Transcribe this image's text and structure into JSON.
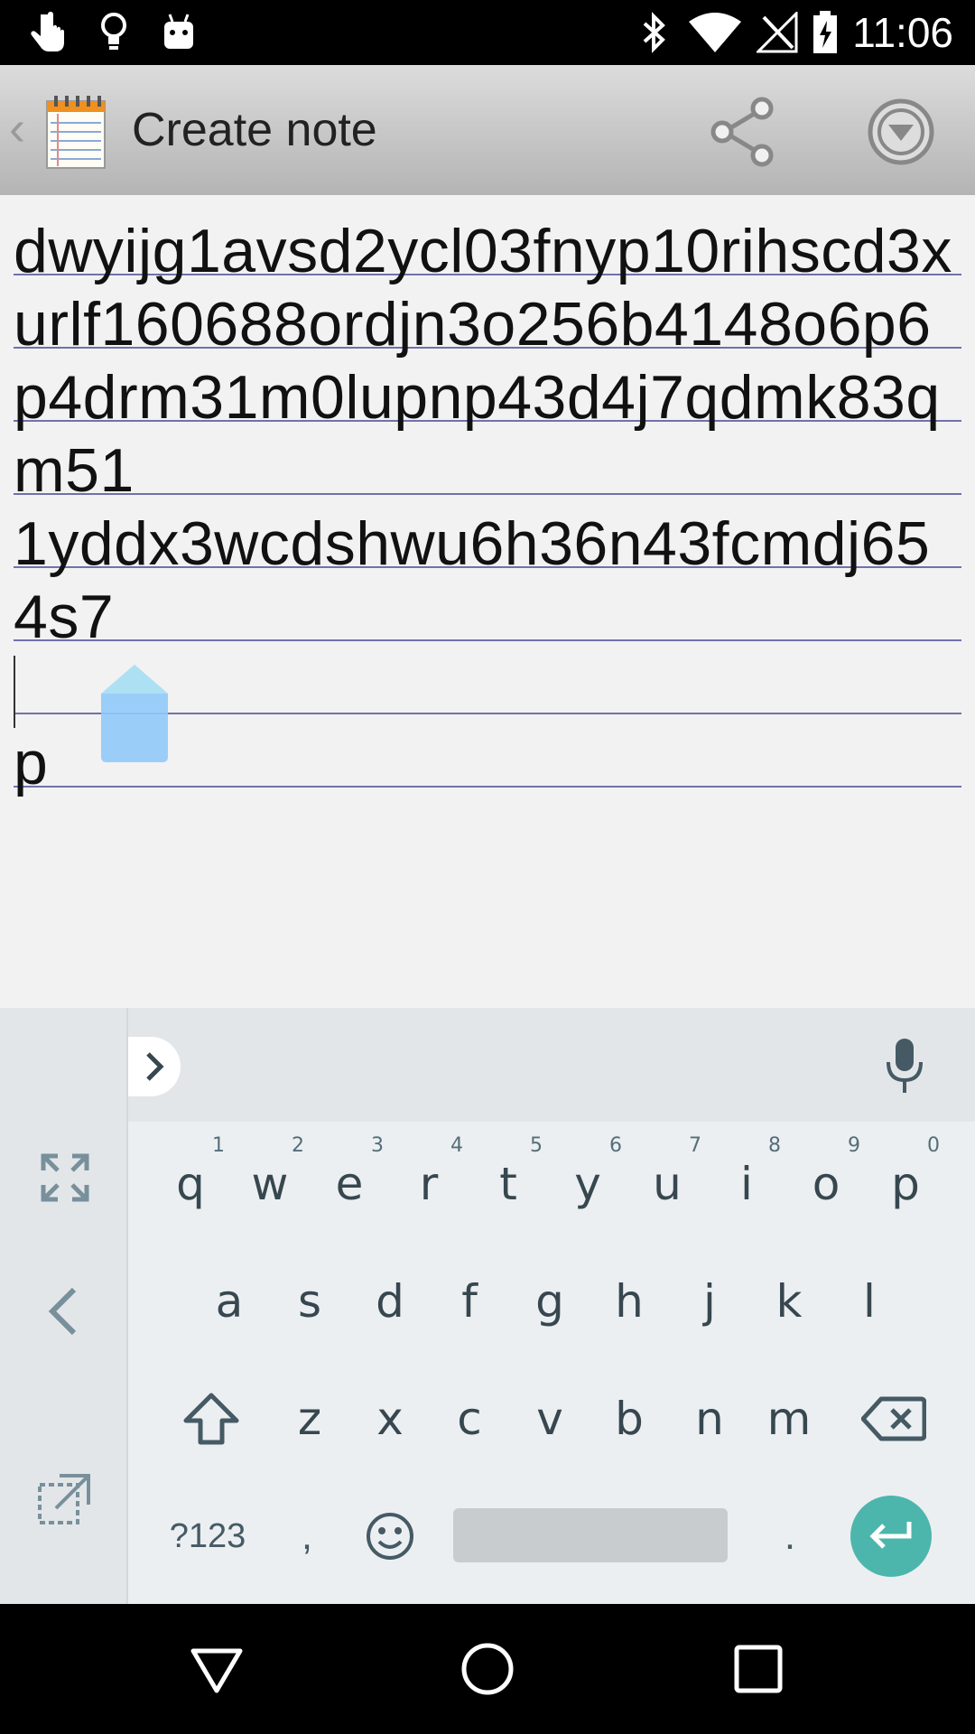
{
  "status_bar": {
    "time": "11:06",
    "left_icons": [
      "touch-icon",
      "lightbulb-icon",
      "android-icon"
    ],
    "right_icons": [
      "bluetooth-icon",
      "wifi-icon",
      "no-signal-icon",
      "battery-charging-icon"
    ]
  },
  "action_bar": {
    "back_glyph": "‹",
    "title": "Create note",
    "share_icon": "share-icon",
    "menu_icon": "overflow-menu-icon"
  },
  "note": {
    "text": "dwyijg1avsd2ycl03fnyp10rihscd3xurlf160688ordjn3o256b4148o6p6p4drm31m0lupnp43d4j7qdmk83qm51\n1yddx3wcdshwu6h36n43fcmdj654s7\n\np"
  },
  "keyboard": {
    "row1": [
      {
        "label": "q",
        "hint": "1"
      },
      {
        "label": "w",
        "hint": "2"
      },
      {
        "label": "e",
        "hint": "3"
      },
      {
        "label": "r",
        "hint": "4"
      },
      {
        "label": "t",
        "hint": "5"
      },
      {
        "label": "y",
        "hint": "6"
      },
      {
        "label": "u",
        "hint": "7"
      },
      {
        "label": "i",
        "hint": "8"
      },
      {
        "label": "o",
        "hint": "9"
      },
      {
        "label": "p",
        "hint": "0"
      }
    ],
    "row2": [
      "a",
      "s",
      "d",
      "f",
      "g",
      "h",
      "j",
      "k",
      "l"
    ],
    "row3": [
      "z",
      "x",
      "c",
      "v",
      "b",
      "n",
      "m"
    ],
    "symbols_label": "?123",
    "comma_label": ",",
    "period_label": "."
  },
  "colors": {
    "enter_key": "#4db6ac",
    "cursor_handle": "#90caf9",
    "rule_line": "#5a5aa0"
  }
}
